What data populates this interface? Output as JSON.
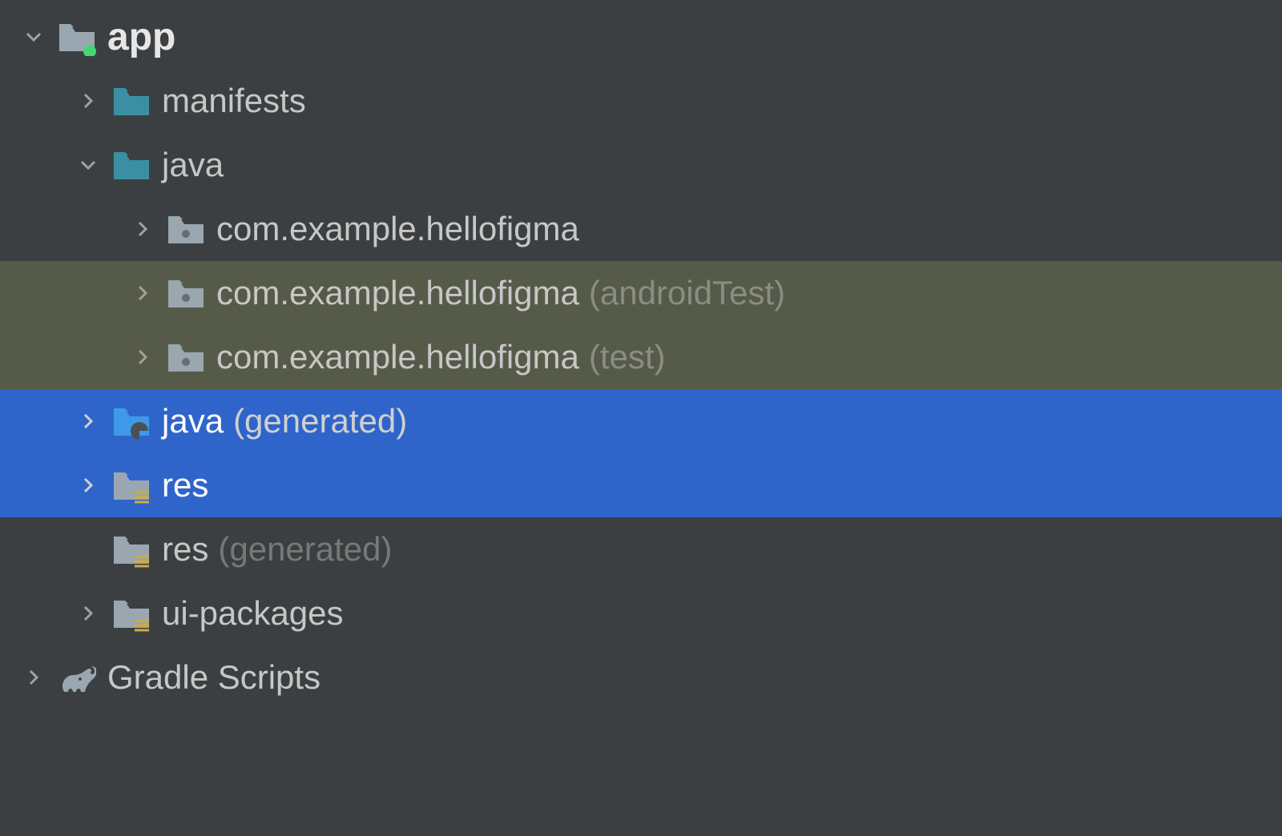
{
  "tree": {
    "app": {
      "label": "app",
      "manifests": {
        "label": "manifests"
      },
      "java": {
        "label": "java",
        "pkg_main": {
          "label": "com.example.hellofigma"
        },
        "pkg_android_test": {
          "label": "com.example.hellofigma",
          "suffix": "(androidTest)"
        },
        "pkg_test": {
          "label": "com.example.hellofigma",
          "suffix": "(test)"
        }
      },
      "java_generated": {
        "label": "java",
        "suffix": "(generated)"
      },
      "res": {
        "label": "res"
      },
      "res_generated": {
        "label": "res",
        "suffix": "(generated)"
      },
      "ui_packages": {
        "label": "ui-packages"
      }
    },
    "gradle_scripts": {
      "label": "Gradle Scripts"
    }
  }
}
